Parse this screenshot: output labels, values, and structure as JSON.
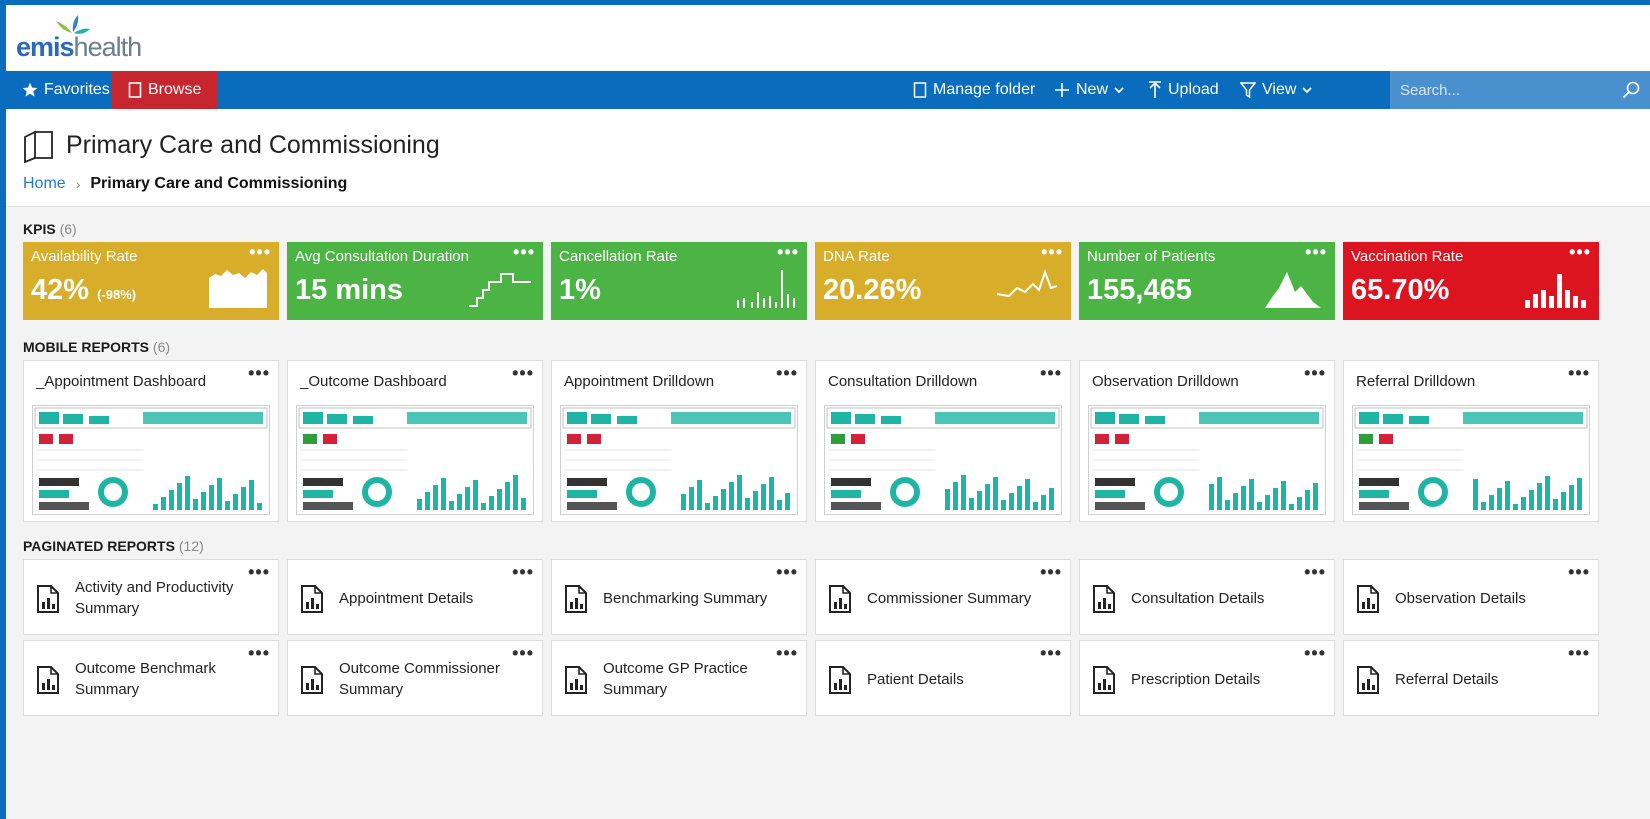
{
  "brand": {
    "name_bold": "emis",
    "name_light": "health"
  },
  "nav": {
    "favorites": "Favorites",
    "browse": "Browse",
    "manage_folder": "Manage folder",
    "new": "New",
    "upload": "Upload",
    "view": "View",
    "search_placeholder": "Search..."
  },
  "page": {
    "title": "Primary Care and Commissioning",
    "breadcrumb_home": "Home",
    "breadcrumb_current": "Primary Care and Commissioning"
  },
  "kpis": {
    "label": "KPIS",
    "count": "(6)",
    "items": [
      {
        "title": "Availability Rate",
        "value": "42%",
        "sub": "(-98%)",
        "color": "#d7ad29",
        "spark": "area"
      },
      {
        "title": "Avg Consultation Duration",
        "value": "15 mins",
        "sub": "",
        "color": "#4cb345",
        "spark": "step"
      },
      {
        "title": "Cancellation Rate",
        "value": "1%",
        "sub": "",
        "color": "#4cb345",
        "spark": "bars"
      },
      {
        "title": "DNA Rate",
        "value": "20.26%",
        "sub": "",
        "color": "#d7ad29",
        "spark": "line"
      },
      {
        "title": "Number of Patients",
        "value": "155,465",
        "sub": "",
        "color": "#4cb345",
        "spark": "mountain"
      },
      {
        "title": "Vaccination Rate",
        "value": "65.70%",
        "sub": "",
        "color": "#dc1420",
        "spark": "bars2"
      }
    ]
  },
  "mobile_reports": {
    "label": "MOBILE REPORTS",
    "count": "(6)",
    "items": [
      {
        "title": "_Appointment Dashboard"
      },
      {
        "title": "_Outcome Dashboard"
      },
      {
        "title": "Appointment Drilldown"
      },
      {
        "title": "Consultation Drilldown"
      },
      {
        "title": "Observation Drilldown"
      },
      {
        "title": "Referral Drilldown"
      }
    ]
  },
  "paginated_reports": {
    "label": "PAGINATED REPORTS",
    "count": "(12)",
    "row1": [
      {
        "title": "Activity and Productivity Summary"
      },
      {
        "title": "Appointment Details"
      },
      {
        "title": "Benchmarking Summary"
      },
      {
        "title": "Commissioner Summary"
      },
      {
        "title": "Consultation Details"
      },
      {
        "title": "Observation Details"
      }
    ],
    "row2": [
      {
        "title": "Outcome Benchmark Summary"
      },
      {
        "title": "Outcome Commissioner Summary"
      },
      {
        "title": "Outcome GP Practice Summary"
      },
      {
        "title": "Patient Details"
      },
      {
        "title": "Prescription Details"
      },
      {
        "title": "Referral Details"
      }
    ]
  },
  "more_label": "•••",
  "colors": {
    "nav": "#0a6cbc",
    "browse_active": "#c8262f",
    "teal": "#1fb5a5"
  }
}
